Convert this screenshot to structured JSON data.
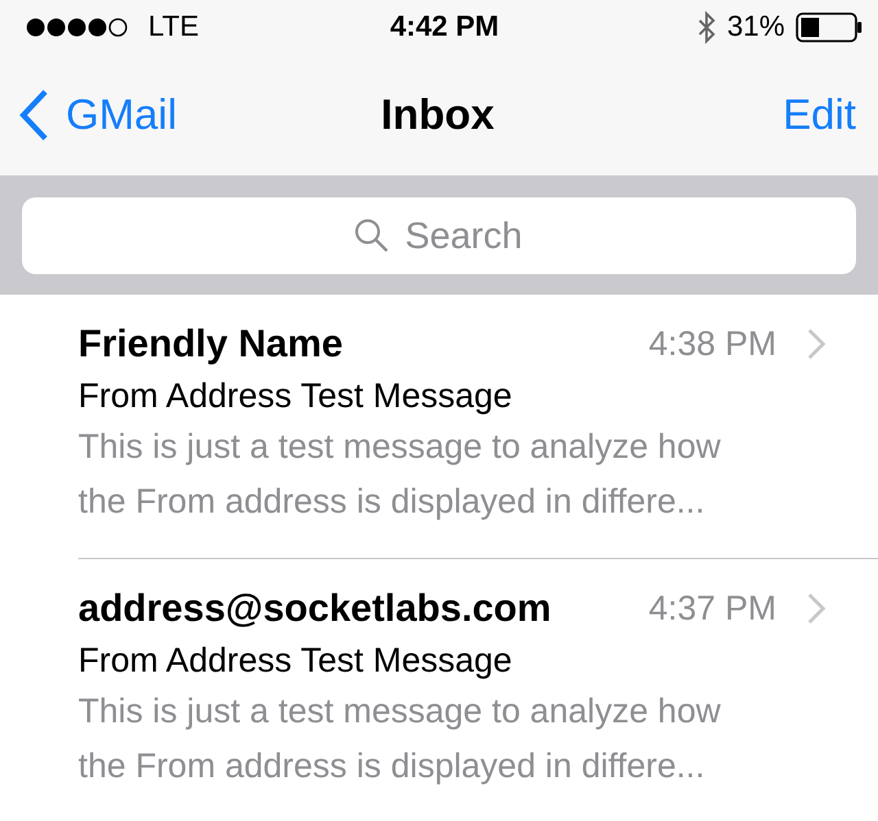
{
  "status_bar": {
    "carrier": "LTE",
    "time": "4:42 PM",
    "battery": "31%"
  },
  "nav_bar": {
    "back": "GMail",
    "title": "Inbox",
    "action": "Edit"
  },
  "search": {
    "placeholder": "Search"
  },
  "messages": [
    {
      "sender": "Friendly Name",
      "time": "4:38 PM",
      "subject": "From Address Test Message",
      "preview": "This is just a test message to analyze how the From address is displayed in differe..."
    },
    {
      "sender": "address@socketlabs.com",
      "time": "4:37 PM",
      "subject": "From Address Test Message",
      "preview": "This is just a test message to analyze how the From address is displayed in differe..."
    }
  ]
}
